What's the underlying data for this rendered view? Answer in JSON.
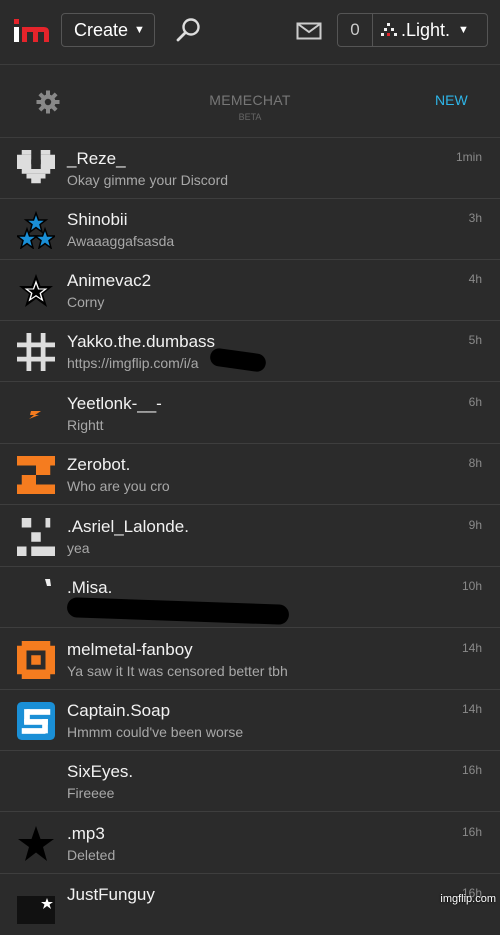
{
  "topbar": {
    "logo_text": "im",
    "create_label": "Create",
    "notif_count": "0",
    "username": ".Light."
  },
  "chat": {
    "title": "MEMECHAT",
    "beta": "BETA",
    "new_label": "NEW"
  },
  "conversations": [
    {
      "name": "_Reze_",
      "preview": "Okay gimme your Discord",
      "time": "1min",
      "avatar_icon": "pixel-heart-icon"
    },
    {
      "name": "Shinobii",
      "preview": "Awaaaggafsasda",
      "time": "3h",
      "avatar_icon": "three-stars-icon"
    },
    {
      "name": "Animevac2",
      "preview": "Corny",
      "time": "4h",
      "avatar_icon": "star-outline-icon"
    },
    {
      "name": "Yakko.the.dumbass",
      "preview": "https://imgflip.com/i/a",
      "time": "5h",
      "avatar_icon": "pixel-grid-icon"
    },
    {
      "name": "Yeetlonk-__-",
      "preview": "Rightt",
      "time": "6h",
      "avatar_icon": "lightning-icon"
    },
    {
      "name": "Zerobot.",
      "preview": "Who are you cro",
      "time": "8h",
      "avatar_icon": "pixel-z-icon"
    },
    {
      "name": ".Asriel_Lalonde.",
      "preview": "yea",
      "time": "9h",
      "avatar_icon": "pixel-face-icon"
    },
    {
      "name": ".Misa.",
      "preview": "",
      "time": "10h",
      "avatar_icon": "small-mark-icon"
    },
    {
      "name": "melmetal-fanboy",
      "preview": "Ya saw it It was censored better tbh",
      "time": "14h",
      "avatar_icon": "pixel-nut-icon"
    },
    {
      "name": "Captain.Soap",
      "preview": "Hmmm could've been worse",
      "time": "14h",
      "avatar_icon": "pixel-s-icon"
    },
    {
      "name": "SixEyes.",
      "preview": "Fireeee",
      "time": "16h",
      "avatar_icon": "blank-avatar-icon"
    },
    {
      "name": ".mp3",
      "preview": "Deleted",
      "time": "16h",
      "avatar_icon": "black-star-icon"
    },
    {
      "name": "JustFunguy",
      "preview": "",
      "time": "16h",
      "avatar_icon": "dark-star-icon"
    }
  ],
  "watermark": "imgflip.com",
  "colors": {
    "background": "#2b2b2b",
    "accent": "#2eb5e8",
    "logo_red": "#e5242b",
    "orange_avatar": "#f57c1f",
    "blue_avatar": "#1a8fd6"
  }
}
